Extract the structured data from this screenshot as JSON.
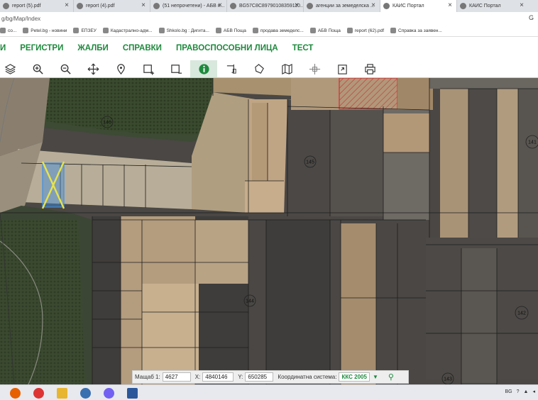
{
  "browser": {
    "tabs": [
      {
        "title": "report (5).pdf",
        "active": false
      },
      {
        "title": "report (4).pdf",
        "active": false
      },
      {
        "title": "(51 непрочетени) - АБВ п...",
        "active": false
      },
      {
        "title": "BG57C8C89790108359110...",
        "active": false
      },
      {
        "title": "агенции за земеделска ...",
        "active": false
      },
      {
        "title": "КАИС Портал",
        "active": true
      },
      {
        "title": "КАИС Портал",
        "active": false
      }
    ],
    "address": "g/bg/Map/Index",
    "address_right": "G",
    "bookmarks": [
      "co...",
      "Petel.bg - новини",
      "ЕПЗЕУ",
      "Кадастрално-адм...",
      "Shkolo.bg : Дигита...",
      "АБВ Поща",
      "продава земеделс...",
      "АБВ Поща",
      "report (62).pdf",
      "Справка за заявен..."
    ]
  },
  "nav": {
    "items": [
      "И",
      "РЕГИСТРИ",
      "ЖАЛБИ",
      "СПРАВКИ",
      "ПРАВОСПОСОБНИ ЛИЦА",
      "ТЕСТ"
    ]
  },
  "toolbar": {
    "tools": [
      {
        "name": "layers-icon",
        "active": false
      },
      {
        "name": "zoom-in-icon",
        "active": false
      },
      {
        "name": "zoom-out-icon",
        "active": false
      },
      {
        "name": "pan-icon",
        "active": false
      },
      {
        "name": "location-pin-icon",
        "active": false
      },
      {
        "name": "select-plus-icon",
        "active": false
      },
      {
        "name": "select-minus-icon",
        "active": false
      },
      {
        "name": "info-icon",
        "active": true
      },
      {
        "name": "measure-distance-icon",
        "active": false
      },
      {
        "name": "measure-area-icon",
        "active": false
      },
      {
        "name": "map-book-icon",
        "active": false
      },
      {
        "name": "crosshair-icon",
        "active": false
      },
      {
        "name": "export-icon",
        "active": false
      },
      {
        "name": "print-icon",
        "active": false
      }
    ]
  },
  "map": {
    "parcel_labels": [
      "146",
      "145",
      "141",
      "144",
      "142",
      "143"
    ],
    "colors": {
      "hatch": "#d32f2f",
      "selection_fill": "#3e8fe0",
      "selection_cross": "#e8e34a"
    }
  },
  "status": {
    "scale_label": "Мащаб 1:",
    "scale_value": "4627",
    "x_label": "X:",
    "x_value": "4840146",
    "y_label": "Y:",
    "y_value": "650285",
    "system_label": "Координатна система:",
    "system_value": "ККС 2005"
  },
  "taskbar": {
    "apps": [
      "firefox-icon",
      "chrome-icon",
      "file-explorer-icon",
      "user-app-icon",
      "viber-icon",
      "word-icon"
    ],
    "tray_text": "BG"
  }
}
